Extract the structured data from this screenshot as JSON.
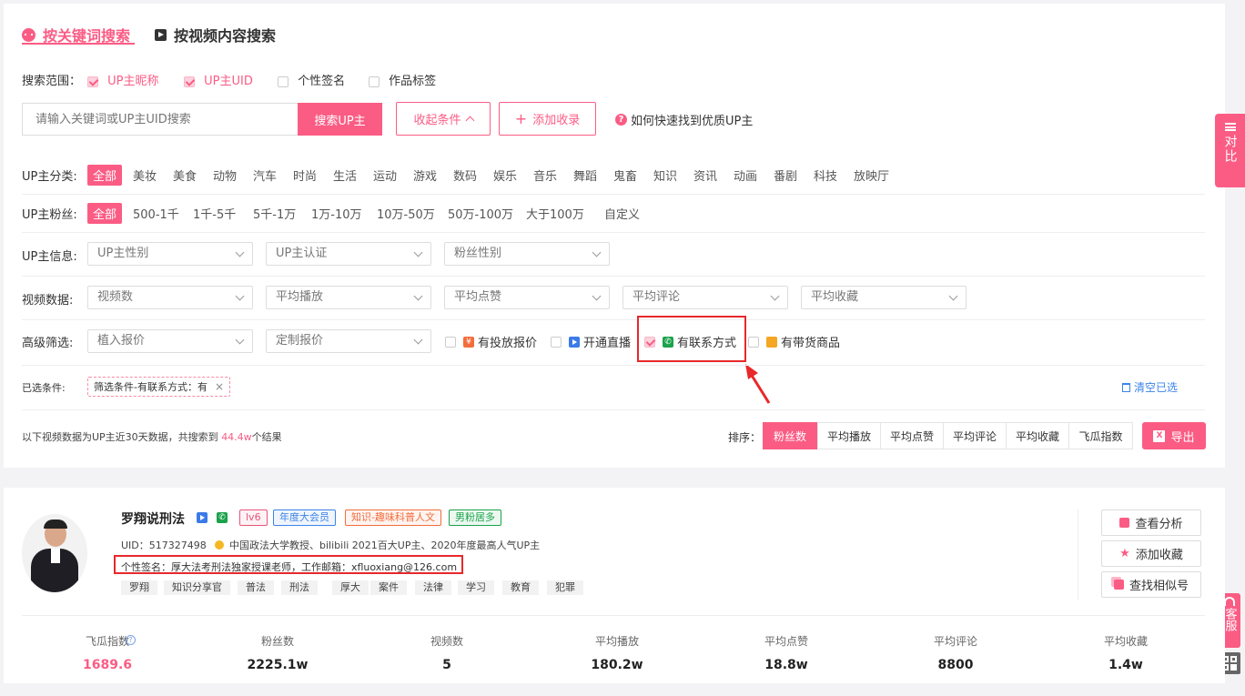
{
  "tabs": {
    "keyword": "按关键词搜索",
    "video": "按视频内容搜索"
  },
  "scope": {
    "label": "搜索范围：",
    "options": [
      {
        "label": "UP主昵称",
        "checked": true
      },
      {
        "label": "UP主UID",
        "checked": true
      },
      {
        "label": "个性签名",
        "checked": false
      },
      {
        "label": "作品标签",
        "checked": false
      }
    ]
  },
  "search": {
    "placeholder": "请输入关键词或UP主UID搜索",
    "button": "搜索UP主",
    "collapse": "收起条件",
    "add_favorite": "添加收录",
    "help": "如何快速找到优质UP主"
  },
  "category": {
    "label": "UP主分类:",
    "items": [
      "全部",
      "美妆",
      "美食",
      "动物",
      "汽车",
      "时尚",
      "生活",
      "运动",
      "游戏",
      "数码",
      "娱乐",
      "音乐",
      "舞蹈",
      "鬼畜",
      "知识",
      "资讯",
      "动画",
      "番剧",
      "科技",
      "放映厅"
    ]
  },
  "fans": {
    "label": "UP主粉丝:",
    "items": [
      "全部",
      "500-1千",
      "1千-5千",
      "5千-1万",
      "1万-10万",
      "10万-50万",
      "50万-100万",
      "大于100万",
      "自定义"
    ]
  },
  "info": {
    "label": "UP主信息:",
    "selects": [
      "UP主性别",
      "UP主认证",
      "粉丝性别"
    ]
  },
  "video_data": {
    "label": "视频数据:",
    "selects": [
      "视频数",
      "平均播放",
      "平均点赞",
      "平均评论",
      "平均收藏"
    ]
  },
  "advanced": {
    "label": "高级筛选:",
    "selects": [
      "植入报价",
      "定制报价"
    ],
    "checks": [
      {
        "label": "有投放报价",
        "checked": false,
        "icon_color": "#f36d3c"
      },
      {
        "label": "开通直播",
        "checked": false,
        "icon_color": "#3b7be8"
      },
      {
        "label": "有联系方式",
        "checked": true,
        "icon_color": "#19a34a"
      },
      {
        "label": "有带货商品",
        "checked": false,
        "icon_color": "#f5a623"
      }
    ]
  },
  "selected": {
    "label": "已选条件:",
    "chip": "筛选条件-有联系方式：有",
    "clear": "清空已选"
  },
  "results": {
    "summary_prefix": "以下视频数据为UP主近30天数据，共搜索到",
    "count": "44.4w",
    "summary_suffix": "个结果",
    "sort_label": "排序：",
    "sort_options": [
      "粉丝数",
      "平均播放",
      "平均点赞",
      "平均评论",
      "平均收藏",
      "飞瓜指数"
    ],
    "export": "导出"
  },
  "side": {
    "compare": "对比",
    "service": "客服"
  },
  "card": {
    "name": "罗翔说刑法",
    "badges": [
      {
        "text": "lv6",
        "color": "#e8557a"
      },
      {
        "text": "年度大会员",
        "color": "#3b84e8"
      },
      {
        "text": "知识-趣味科普人文",
        "color": "#f36d3c"
      },
      {
        "text": "男粉居多",
        "color": "#19a34a"
      }
    ],
    "uid": "UID：517327498",
    "certification": "中国政法大学教授、bilibili 2021百大UP主、2020年度最高人气UP主",
    "signature": "个性签名：厚大法考刑法独家授课老师，工作邮箱：xfluoxiang@126.com",
    "tags": [
      "罗翔",
      "知识分享官",
      "普法",
      "刑法",
      "厚大",
      "案件",
      "法律",
      "学习",
      "教育",
      "犯罪"
    ],
    "actions": [
      "查看分析",
      "添加收藏",
      "查找相似号"
    ],
    "stats": [
      {
        "label": "飞瓜指数",
        "value": "1689.6"
      },
      {
        "label": "粉丝数",
        "value": "2225.1w"
      },
      {
        "label": "视频数",
        "value": "5"
      },
      {
        "label": "平均播放",
        "value": "180.2w"
      },
      {
        "label": "平均点赞",
        "value": "18.8w"
      },
      {
        "label": "平均评论",
        "value": "8800"
      },
      {
        "label": "平均收藏",
        "value": "1.4w"
      }
    ]
  }
}
